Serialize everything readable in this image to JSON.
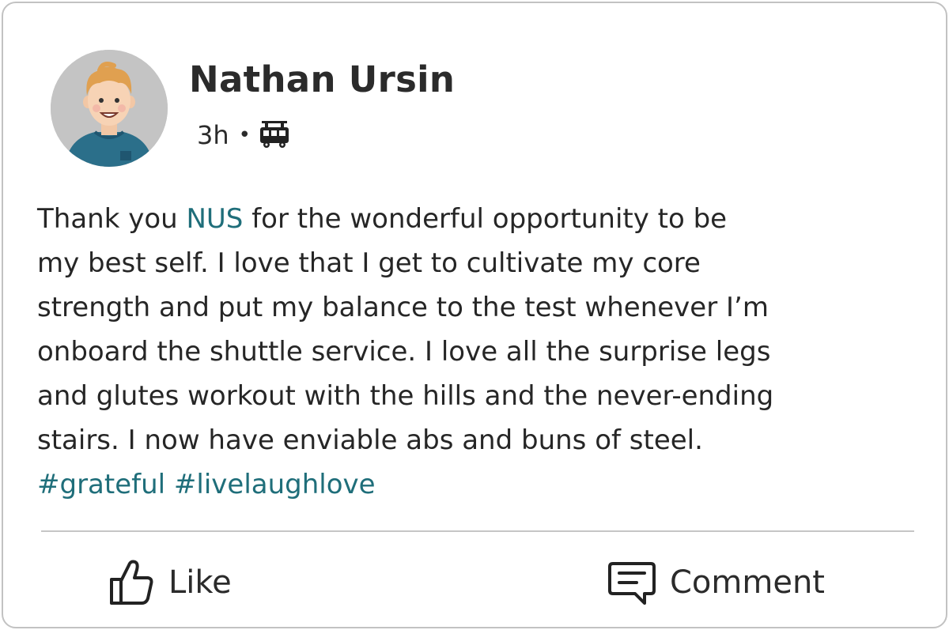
{
  "post": {
    "author": "Nathan Ursin",
    "time": "3h",
    "separator": "•",
    "audience_icon": "bus-icon",
    "body_lines": [
      {
        "pre": "Thank you ",
        "mention": "NUS",
        "post": " for the wonderful opportunity to be"
      },
      {
        "text": "my best self. I love that I get to cultivate my core"
      },
      {
        "text": "strength and put my balance to the test whenever I’m"
      },
      {
        "text": "onboard the shuttle service. I love all the surprise legs"
      },
      {
        "text": "and glutes workout with the hills and the never-ending"
      },
      {
        "text": "stairs. I now have enviable abs and buns of steel."
      }
    ],
    "hashtags": "#grateful #livelaughlove"
  },
  "actions": {
    "like_label": "Like",
    "like_icon": "thumbs-up-icon",
    "comment_label": "Comment",
    "comment_icon": "comment-icon"
  },
  "colors": {
    "accent": "#1f6e7a",
    "text": "#262626",
    "border": "#c2c2c2",
    "avatar_bg": "#c4c4c4",
    "shirt": "#2b6f8a",
    "hair": "#e0a050"
  }
}
